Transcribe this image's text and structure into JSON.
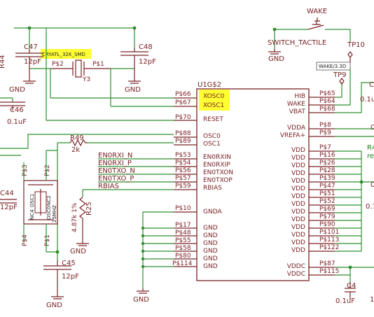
{
  "chip": {
    "name": "U1G$2",
    "left_pins": [
      {
        "num": "P$66",
        "name": "XOSC0"
      },
      {
        "num": "P$67",
        "name": "XOSC1"
      },
      {
        "num": "P$70",
        "name": "RESET"
      },
      {
        "num": "P$88",
        "name": "OSC0"
      },
      {
        "num": "P$89",
        "name": "OSC1"
      },
      {
        "num": "P$53",
        "name": "EN0RXIN"
      },
      {
        "num": "P$54",
        "name": "EN0RXIP"
      },
      {
        "num": "P$56",
        "name": "EN0TXON"
      },
      {
        "num": "P$57",
        "name": "EN0TXOP"
      },
      {
        "num": "P$59",
        "name": "RBIAS"
      },
      {
        "num": "P$10",
        "name": "GNDA"
      },
      {
        "num": "P$17",
        "name": "GND"
      },
      {
        "num": "P$48",
        "name": "GND"
      },
      {
        "num": "P$55",
        "name": "GND"
      },
      {
        "num": "P$58",
        "name": "GND"
      },
      {
        "num": "P$80",
        "name": "GND"
      },
      {
        "num": "P$114",
        "name": "GND"
      }
    ],
    "right_pins": [
      {
        "num": "P$65",
        "name": "HIB"
      },
      {
        "num": "P$64",
        "name": "WAKE"
      },
      {
        "num": "P$68",
        "name": "VBAT"
      },
      {
        "num": "P$8",
        "name": "VDDA"
      },
      {
        "num": "P$9",
        "name": "VREFA+"
      },
      {
        "num": "P$7",
        "name": "VDD"
      },
      {
        "num": "P$16",
        "name": "VDD"
      },
      {
        "num": "P$26",
        "name": "VDD"
      },
      {
        "num": "P$28",
        "name": "VDD"
      },
      {
        "num": "P$39",
        "name": "VDD"
      },
      {
        "num": "P$47",
        "name": "VDD"
      },
      {
        "num": "P$51",
        "name": "VDD"
      },
      {
        "num": "P$52",
        "name": "VDD"
      },
      {
        "num": "P$69",
        "name": "VDD"
      },
      {
        "num": "P$79",
        "name": "VDD"
      },
      {
        "num": "P$90",
        "name": "VDD"
      },
      {
        "num": "P$101",
        "name": "VDD"
      },
      {
        "num": "P$113",
        "name": "VDD"
      },
      {
        "num": "P$122",
        "name": "VDD"
      },
      {
        "num": "P$87",
        "name": "VDDC"
      },
      {
        "num": "P$115",
        "name": "VDDC"
      }
    ]
  },
  "nets": {
    "en0rxi_n": "EN0RXI_N",
    "en0rxi_p": "EN0RXI_P",
    "en0txo_n": "EN0TXO_N",
    "en0txo_p": "EN0TXO_P",
    "rbias": "RBIAS"
  },
  "components": {
    "c47": {
      "ref": "C47",
      "value": "12pF"
    },
    "c48": {
      "ref": "C48",
      "value": "12pF"
    },
    "c46": {
      "ref": "C46",
      "value": "0.1uF"
    },
    "c44": {
      "ref": "C44",
      "value": "12pF"
    },
    "c45": {
      "ref": "C45",
      "value": "12pF"
    },
    "c4": {
      "ref": "C4",
      "value": "0.1uF"
    },
    "r44": {
      "ref": "R44"
    },
    "r49": {
      "ref": "R49",
      "value": "2k"
    },
    "r25": {
      "ref": "R25",
      "value": "4.87k 1%"
    },
    "y3": {
      "ref": "Y3",
      "label": "CRYATL_32K_SMD",
      "pin2": "P$2",
      "pin1": "P$1"
    },
    "osc1": {
      "ref": "OSC1",
      "pins": [
        "P$3",
        "P$2",
        "P$4",
        "P$1"
      ],
      "nc": [
        "NC4",
        "NC2"
      ],
      "label": "OSC0",
      "freq": "25MHZ"
    },
    "switch": {
      "net": "WAKE",
      "name": "SWITCH_TACTILE"
    },
    "tp10": {
      "ref": "TP10"
    },
    "tp9": {
      "ref": "TP9"
    },
    "wake_label": "WAKE/3.3D",
    "partial_right": {
      "r_label": "R4",
      "r_sub": "re",
      "c_top": "C",
      "c_val": "0.1u",
      "c_val2": "0.1u",
      "c_side": "C",
      "c_side2": "C",
      "one": "1"
    }
  },
  "gnd_label": "GND",
  "highlight_color": "#ffff33",
  "schematic_color": "#7a2326",
  "wire_color": "#2f8f2f"
}
